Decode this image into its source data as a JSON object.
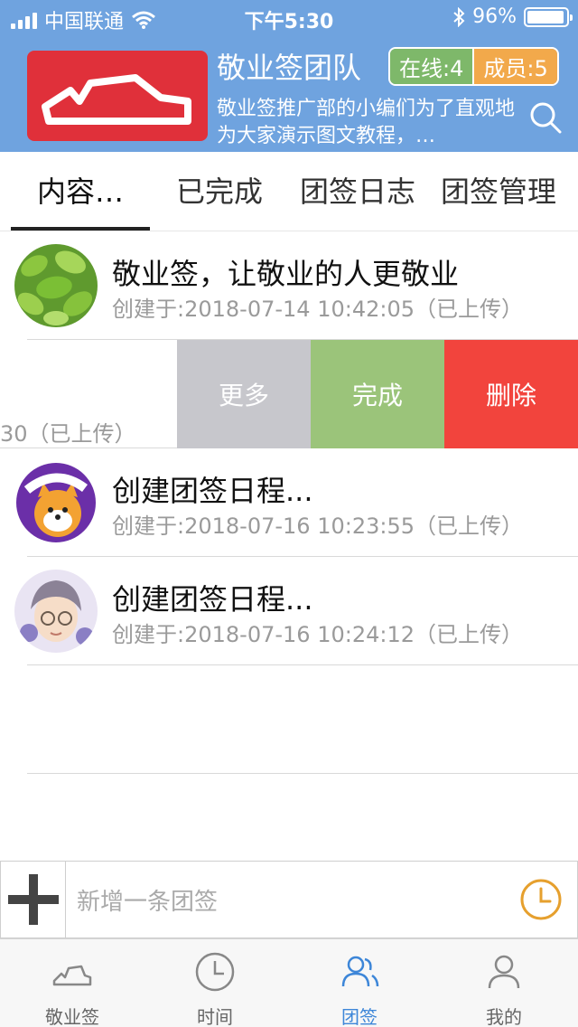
{
  "status_bar": {
    "carrier": "中国联通",
    "time": "下午5:30",
    "battery": "96%",
    "battery_level": 0.96
  },
  "header": {
    "group_name": "敬业签团队",
    "online_label": "在线:4",
    "members_label": "成员:5",
    "description": "敬业签推广部的小编们为了直观地为大家演示图文教程，…"
  },
  "tabs": [
    "内容…",
    "已完成",
    "团签日志",
    "团签管理"
  ],
  "notes": [
    {
      "title": "敬业签，让敬业的人更敬业",
      "meta": "创建于:2018-07-14 10:42:05（已上传）"
    },
    {
      "title": "创建团签日程...",
      "meta": "创建于:2018-07-16 10:23:55（已上传）"
    },
    {
      "title": "创建团签日程...",
      "meta": "创建于:2018-07-16 10:24:12（已上传）"
    }
  ],
  "swiped_row": {
    "meta_fragment": "30（已上传）",
    "actions": [
      {
        "label": "更多",
        "color": "#c7c7cc"
      },
      {
        "label": "完成",
        "color": "#9bc47a"
      },
      {
        "label": "删除",
        "color": "#f2443d"
      }
    ]
  },
  "input": {
    "placeholder": "新增一条团签"
  },
  "bottom_nav": [
    {
      "label": "敬业签",
      "icon": "shoe-icon"
    },
    {
      "label": "时间",
      "icon": "clock-icon"
    },
    {
      "label": "团签",
      "icon": "group-icon",
      "active": true
    },
    {
      "label": "我的",
      "icon": "person-icon"
    }
  ],
  "colors": {
    "header": "#6fa3df",
    "accent": "#3d86d8",
    "online": "#7eb86a",
    "members": "#f2a94b",
    "clock": "#e6a02e"
  }
}
